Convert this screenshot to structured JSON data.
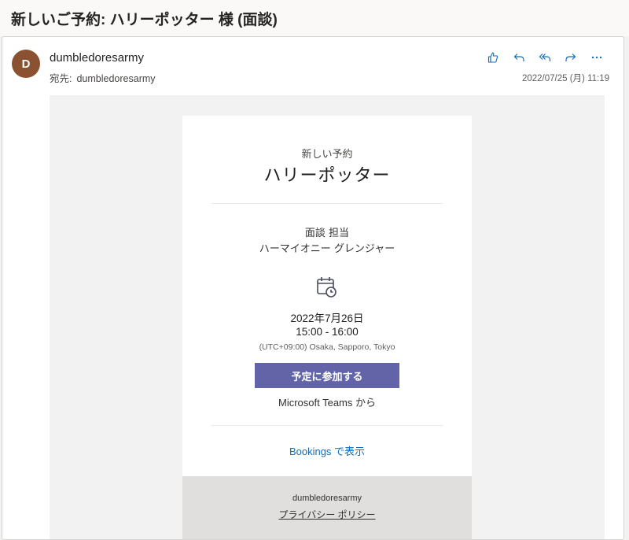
{
  "subject": "新しいご予約: ハリーポッター 様 (面談)",
  "sender": {
    "initial": "D",
    "name": "dumbledoresarmy",
    "to_label": "宛先:",
    "to_value": "dumbledoresarmy",
    "date": "2022/07/25 (月) 11:19",
    "avatar_color": "#8a5230"
  },
  "actions": [
    {
      "name": "like-icon"
    },
    {
      "name": "reply-icon"
    },
    {
      "name": "reply-all-icon"
    },
    {
      "name": "forward-icon"
    },
    {
      "name": "more-icon"
    }
  ],
  "booking": {
    "label": "新しい予約",
    "customer": "ハリーポッター",
    "service": "面談 担当",
    "staff": "ハーマイオニー グレンジャー",
    "date": "2022年7月26日",
    "time": "15:00 - 16:00",
    "timezone": "(UTC+09:00) Osaka, Sapporo, Tokyo",
    "join_button": "予定に参加する",
    "via": "Microsoft Teams から",
    "bookings_link": "Bookings で表示",
    "footer_name": "dumbledoresarmy",
    "privacy_link": "プライバシー ポリシー"
  },
  "colors": {
    "accent_blue": "#0f6cbd",
    "teams_purple": "#6264a7"
  }
}
